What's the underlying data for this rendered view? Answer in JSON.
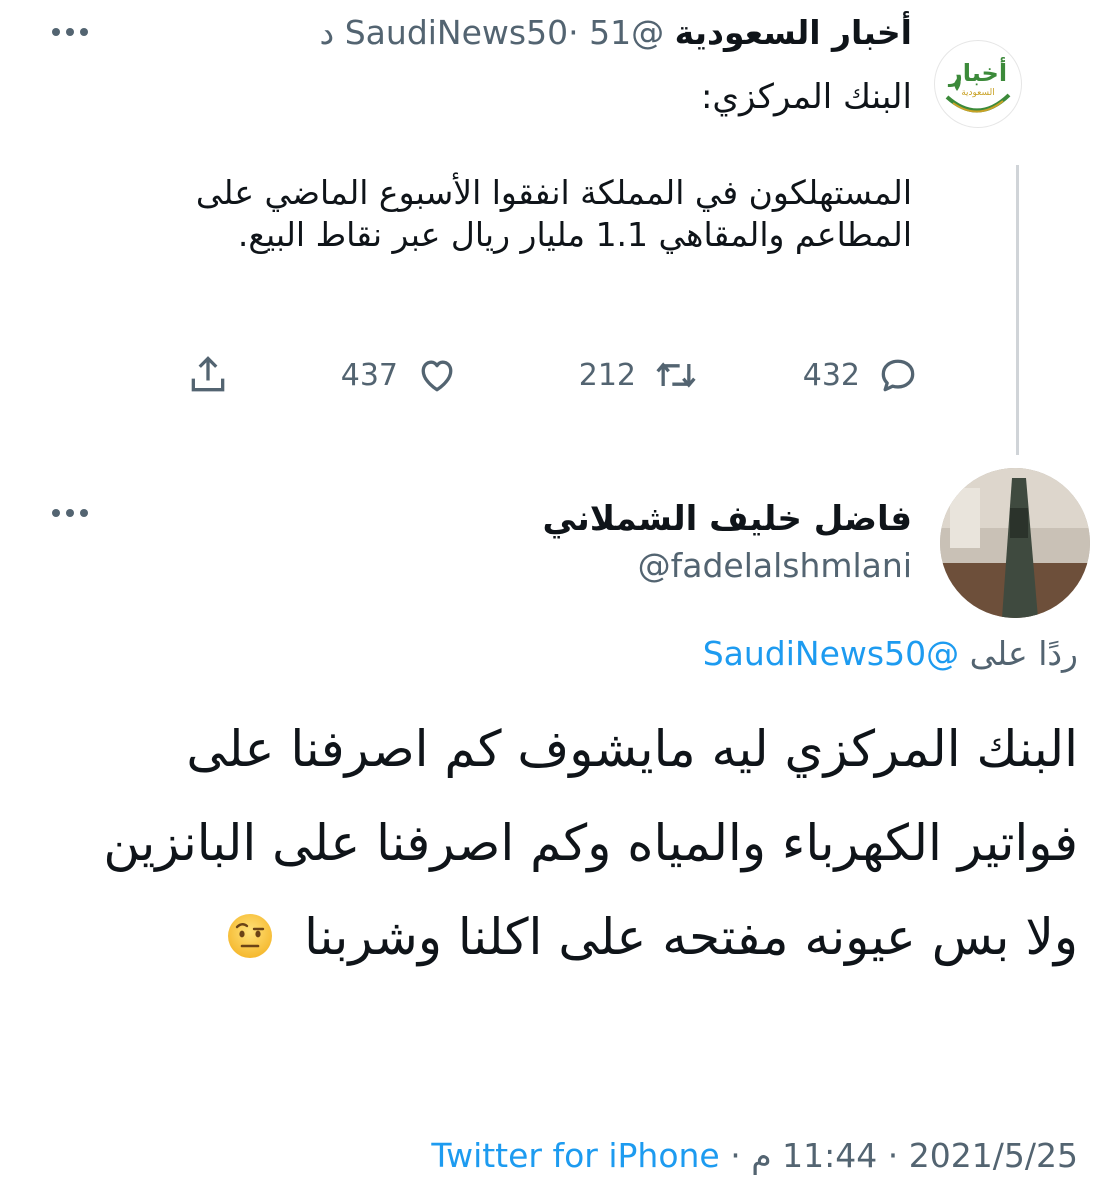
{
  "tweet1": {
    "display_name": "أخبار السعودية",
    "handle": "@SaudiNews50",
    "separator": "·",
    "time": "51 د",
    "subtitle": "البنك المركزي:",
    "body": "المستهلكون في المملكة انفقوا الأسبوع الماضي على المطاعم والمقاهي 1.1 مليار ريال عبر نقاط البيع.",
    "avatar_text": "أخبار",
    "avatar_subtext": "السعودية",
    "reply_count": "432",
    "retweet_count": "212",
    "like_count": "437",
    "icons": {
      "reply": "comment-icon",
      "retweet": "retweet-icon",
      "like": "heart-icon",
      "share": "share-icon",
      "more": "more-options-icon"
    }
  },
  "tweet2": {
    "display_name": "فاضل خليف الشملاني",
    "handle": "@fadelalshmlani",
    "reply_prefix": "ردًا على",
    "reply_mention": "@SaudiNews50",
    "body": "البنك المركزي ليه مايشوف كم اصرفنا على فواتير الكهرباء والمياه وكم اصرفنا على البانزين ولا بس عيونه مفتحه على اكلنا وشربنا",
    "emoji": "face-with-raised-eyebrow-emoji",
    "footer": {
      "date": "2021/5/25",
      "time": "11:44 م",
      "separator": "·",
      "source": "Twitter for iPhone"
    }
  },
  "colors": {
    "text": "#0f1419",
    "muted": "#536471",
    "link": "#1d9bf0",
    "thread_line": "#d0d4d8"
  }
}
